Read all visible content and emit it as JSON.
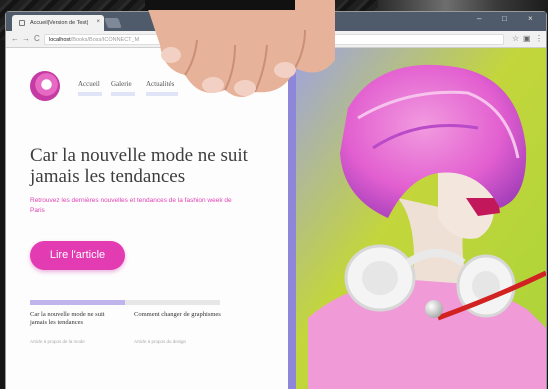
{
  "browser": {
    "tab_title": "Accueil|Version de Test|",
    "tab_close": "×",
    "url_host": "localhost",
    "url_path": "/Books/Boss/ICONNECT_M",
    "nav_back": "←",
    "nav_forward": "→",
    "nav_reload": "C",
    "window_controls": [
      "–",
      "□",
      "×"
    ]
  },
  "site": {
    "nav": [
      "Accueil",
      "Galerie",
      "Actualités"
    ],
    "headline": "Car la nouvelle mode ne suit jamais les tendances",
    "subtitle": "Retrouvez les dernières nouvelles et tendances de la fashion week de Paris",
    "cta_label": "Lire l'article",
    "carousel_progress": 0.5,
    "cards": [
      {
        "title": "Car la nouvelle mode ne suit jamais les tendances",
        "meta": "Article à propos de la mode"
      },
      {
        "title": "Comment changer de graphismes",
        "meta": "Article à propos du design"
      }
    ]
  },
  "colors": {
    "accent": "#e33bb2",
    "nav_underline": "#dfe4f7",
    "progress": "#bfb4ec",
    "tabbar": "#4f5a6a",
    "photo_bg": "#c9d93a",
    "hair": "#e25fd0"
  },
  "icons": [
    "favicon-icon",
    "close-icon",
    "back-icon",
    "forward-icon",
    "reload-icon",
    "star-icon",
    "extension-icon",
    "menu-icon",
    "logo-icon"
  ]
}
